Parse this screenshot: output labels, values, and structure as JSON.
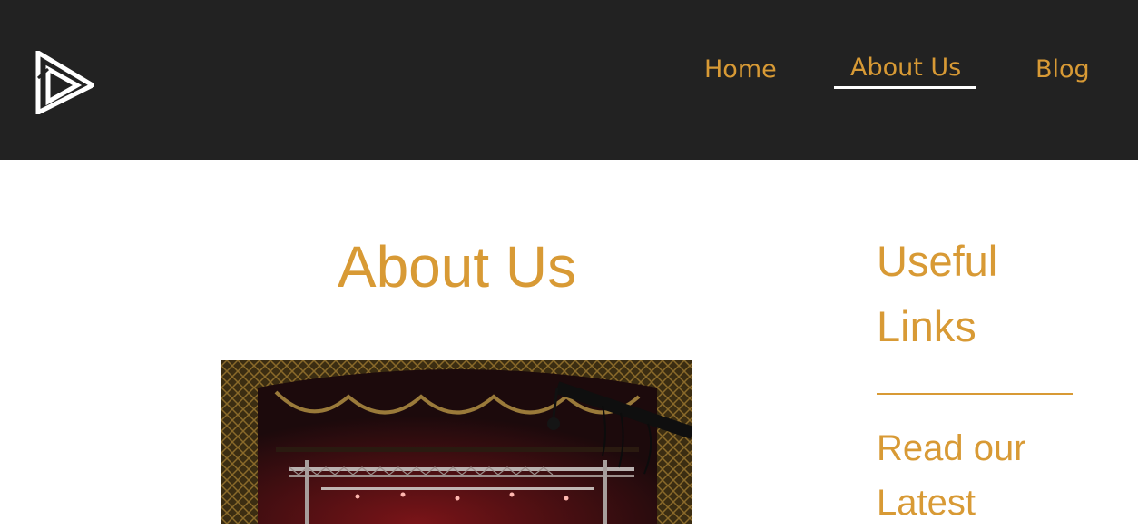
{
  "nav": {
    "items": [
      {
        "label": "Home",
        "active": false
      },
      {
        "label": "About Us",
        "active": true
      },
      {
        "label": "Blog",
        "active": false
      }
    ]
  },
  "main": {
    "title": "About Us"
  },
  "sidebar": {
    "title": "Useful Links",
    "link_label": "Read our Latest"
  },
  "colors": {
    "header_bg": "#222222",
    "accent": "#d89a35",
    "page_bg": "#ffffff"
  },
  "icons": {
    "logo": "play-triangle-logo-icon"
  }
}
